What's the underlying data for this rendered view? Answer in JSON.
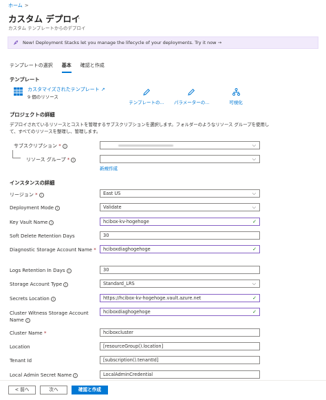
{
  "breadcrumb": {
    "home": "ホーム",
    "sep": ">"
  },
  "header": {
    "title": "カスタム デプロイ",
    "more": "...",
    "subtitle": "カスタム テンプレートからのデプロイ"
  },
  "banner": {
    "text": "New! Deployment Stacks let you manage the lifecycle of your deployments. Try it now  →"
  },
  "tabs": [
    {
      "label": "テンプレートの選択"
    },
    {
      "label": "基本"
    },
    {
      "label": "確認と作成"
    }
  ],
  "template": {
    "section": "テンプレート",
    "name": "カスタマイズされたテンプレート",
    "count": "9 個のリソース",
    "actions": [
      {
        "label": "テンプレートの..."
      },
      {
        "label": "パラメーターの..."
      },
      {
        "label": "可視化"
      }
    ]
  },
  "project": {
    "section": "プロジェクトの詳細",
    "desc": "デプロイされているリソースとコストを管理するサブスクリプションを選択します。フォルダーのようなリソース グループを使用して、すべてのリソースを整理し、管理します。",
    "subscription_label": "サブスクリプション",
    "rg_label": "リソース グループ",
    "rg_value": "",
    "new_link": "新規作成"
  },
  "instance": {
    "section": "インスタンスの詳細",
    "region_label": "リージョン",
    "region_value": "East US",
    "fields": [
      {
        "label": "Deployment Mode",
        "value": "Validate"
      },
      {
        "label": "Key Vault Name",
        "value": "hcibox-kv-hogehoge"
      },
      {
        "label": "Soft Delete Retention Days",
        "value": "30"
      },
      {
        "label": "Diagnostic Storage Account Name",
        "value": "hciboxdiaghogehoge"
      },
      {
        "label": "Logs Retention In Days",
        "value": "30"
      },
      {
        "label": "Storage Account Type",
        "value": "Standard_LRS"
      },
      {
        "label": "Secrets Location",
        "value": "https://hcibox-kv-hogehoge.vault.azure.net"
      },
      {
        "label": "Cluster Witness Storage Account",
        "label2": "Name",
        "value": "hciboxdiaghogehoge"
      },
      {
        "label": "Cluster Name",
        "value": "hciboxcluster"
      },
      {
        "label": "Location",
        "value": "[resourceGroup().location]"
      },
      {
        "label": "Tenant Id",
        "value": "[subscription().tenantId]"
      },
      {
        "label": "Local Admin Secret Name",
        "value": "LocalAdminCredential"
      }
    ]
  },
  "footer": {
    "prev": "< 前へ",
    "next": "次へ",
    "review": "確認と作成"
  },
  "colors": {
    "accent": "#0078d4",
    "valid_border": "#8661c5",
    "banner_bg": "#f1eafb",
    "check": "#107c10"
  }
}
